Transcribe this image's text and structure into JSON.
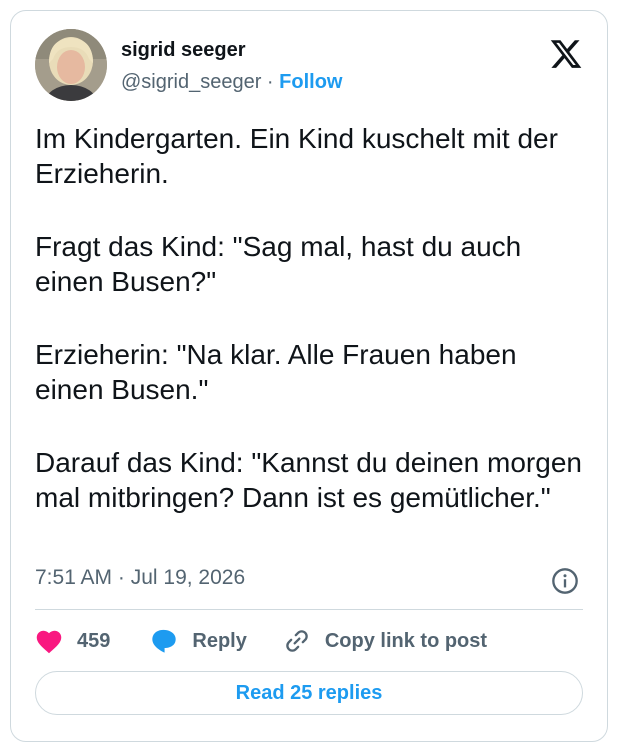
{
  "author": {
    "name": "sigrid seeger",
    "handle": "@sigrid_seeger",
    "separator": " · ",
    "follow_label": "Follow"
  },
  "tweet": {
    "paragraphs": [
      "Im Kindergarten. Ein Kind kuschelt mit der Erzieherin.",
      "Fragt das Kind: \"Sag mal, hast du auch einen Busen?\"",
      "Erzieherin: \"Na klar. Alle Frauen haben einen Busen.\"",
      "Darauf das Kind: \"Kannst du deinen morgen mal mitbringen? Dann ist es gemütlicher.\""
    ],
    "timestamp": "7:51 AM · Jul 19, 2026"
  },
  "actions": {
    "like_count": "459",
    "reply_label": "Reply",
    "copy_link_label": "Copy link to post"
  },
  "read_replies_label": "Read 25 replies",
  "icons": {
    "platform": "x-logo-icon",
    "info": "info-icon",
    "like": "heart-icon",
    "reply": "speech-bubble-icon",
    "copy": "link-icon"
  },
  "colors": {
    "accent": "#1d9bf0",
    "like": "#f91880",
    "muted": "#536471",
    "border": "#cfd9de"
  }
}
